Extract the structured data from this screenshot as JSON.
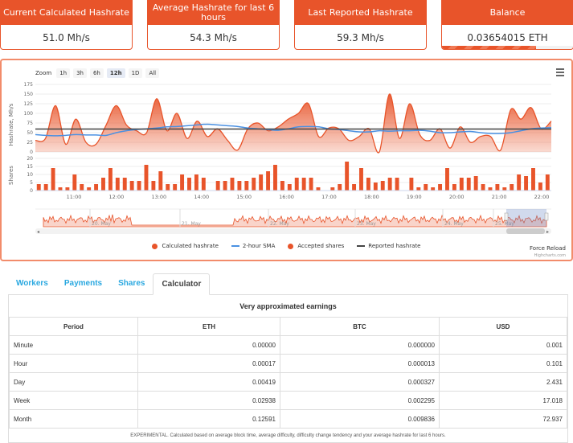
{
  "stats": [
    {
      "label": "Current Calculated Hashrate",
      "value": "51.0 Mh/s"
    },
    {
      "label": "Average Hashrate for last 6 hours",
      "value": "54.3 Mh/s"
    },
    {
      "label": "Last Reported Hashrate",
      "value": "59.3 Mh/s"
    },
    {
      "label": "Balance",
      "value": "0.03654015 ETH",
      "progress": 0.72
    }
  ],
  "chart": {
    "zoom_label": "Zoom",
    "zoom_buttons": [
      "1h",
      "3h",
      "6h",
      "12h",
      "1D",
      "All"
    ],
    "zoom_active": "12h",
    "menu_icon": "hamburger-menu-icon",
    "force_reload": "Force Reload",
    "credits": "Highcharts.com"
  },
  "chart_data": {
    "type": "area",
    "title": "",
    "x": [
      "10:15",
      "10:30",
      "10:45",
      "11:00",
      "11:15",
      "11:30",
      "11:45",
      "12:00",
      "12:15",
      "12:30",
      "12:45",
      "13:00",
      "13:15",
      "13:30",
      "13:45",
      "14:00",
      "14:15",
      "14:30",
      "14:45",
      "15:00",
      "15:15",
      "15:30",
      "15:45",
      "16:00",
      "16:15",
      "16:30",
      "16:45",
      "17:00",
      "17:15",
      "17:30",
      "17:45",
      "18:00",
      "18:15",
      "18:30",
      "18:45",
      "19:00",
      "19:15",
      "19:30",
      "19:45",
      "20:00",
      "20:15",
      "20:30",
      "20:45",
      "21:00",
      "21:15",
      "21:30",
      "21:45",
      "22:00"
    ],
    "xticks": [
      "11:00",
      "12:00",
      "13:00",
      "14:00",
      "15:00",
      "16:00",
      "17:00",
      "18:00",
      "19:00",
      "20:00",
      "21:00",
      "22:00"
    ],
    "hashrate_axis": {
      "label": "Hashrate, Mh/s",
      "ylim": [
        0,
        175
      ],
      "ticks": [
        0,
        25,
        50,
        75,
        100,
        125,
        150,
        175
      ]
    },
    "shares_axis": {
      "label": "Shares",
      "ylim": [
        0,
        20
      ],
      "ticks": [
        0,
        5,
        10,
        15,
        20
      ]
    },
    "series": [
      {
        "name": "Calculated hashrate",
        "color": "#e8542a",
        "values": [
          30,
          35,
          120,
          20,
          85,
          25,
          20,
          70,
          120,
          70,
          55,
          50,
          138,
          55,
          100,
          35,
          80,
          40,
          60,
          30,
          5,
          60,
          75,
          55,
          65,
          85,
          100,
          125,
          40,
          62,
          60,
          30,
          40,
          60,
          0,
          150,
          35,
          125,
          45,
          30,
          60,
          10,
          65,
          25,
          40,
          40,
          5,
          110,
          85,
          115,
          60,
          80
        ]
      },
      {
        "name": "2-hour SMA",
        "color": "#4a90e2",
        "values": [
          45,
          43,
          42,
          43,
          45,
          44,
          44,
          43,
          50,
          55,
          58,
          60,
          62,
          65,
          66,
          68,
          70,
          72,
          70,
          68,
          66,
          62,
          60,
          58,
          56,
          60,
          65,
          66,
          65,
          60,
          58,
          55,
          52,
          52,
          55,
          54,
          55,
          55,
          56,
          54,
          50,
          50,
          52,
          53,
          50,
          48,
          48,
          50,
          55,
          60,
          62,
          63
        ]
      },
      {
        "name": "Reported hashrate",
        "color": "#444444",
        "values": [
          59.3
        ]
      },
      {
        "name": "Accepted shares",
        "color": "#e8542a",
        "values": [
          4,
          4,
          14,
          2,
          2,
          10,
          4,
          2,
          4,
          8,
          14,
          8,
          8,
          6,
          6,
          16,
          6,
          12,
          4,
          4,
          10,
          8,
          10,
          8,
          0,
          6,
          6,
          8,
          6,
          6,
          8,
          10,
          12,
          16,
          6,
          4,
          8,
          8,
          8,
          2,
          0,
          2,
          4,
          18,
          4,
          14,
          8,
          5,
          6,
          8,
          8,
          0,
          8,
          2,
          4,
          2,
          4,
          14,
          4,
          8,
          8,
          9,
          4,
          2,
          4,
          2,
          4,
          10,
          9,
          14,
          5,
          10
        ]
      }
    ],
    "navigator": {
      "labels": [
        "20. May",
        "21. May",
        "22. May",
        "23. May",
        "24. May",
        "25. May"
      ]
    },
    "legend": [
      "Calculated hashrate",
      "2-hour SMA",
      "Accepted shares",
      "Reported hashrate"
    ],
    "legend_position": "bottom-center"
  },
  "tabs": [
    "Workers",
    "Payments",
    "Shares",
    "Calculator"
  ],
  "active_tab": "Calculator",
  "calculator": {
    "title": "Very approximated earnings",
    "headers": [
      "Period",
      "ETH",
      "BTC",
      "USD"
    ],
    "rows": [
      [
        "Minute",
        "0.00000",
        "0.000000",
        "0.001"
      ],
      [
        "Hour",
        "0.00017",
        "0.000013",
        "0.101"
      ],
      [
        "Day",
        "0.00419",
        "0.000327",
        "2.431"
      ],
      [
        "Week",
        "0.02938",
        "0.002295",
        "17.018"
      ],
      [
        "Month",
        "0.12591",
        "0.009836",
        "72.937"
      ]
    ],
    "note": "EXPERIMENTAL. Calculated based on average block time, average difficulty, difficulty change tendency and your average hashrate for last 6 hours."
  }
}
